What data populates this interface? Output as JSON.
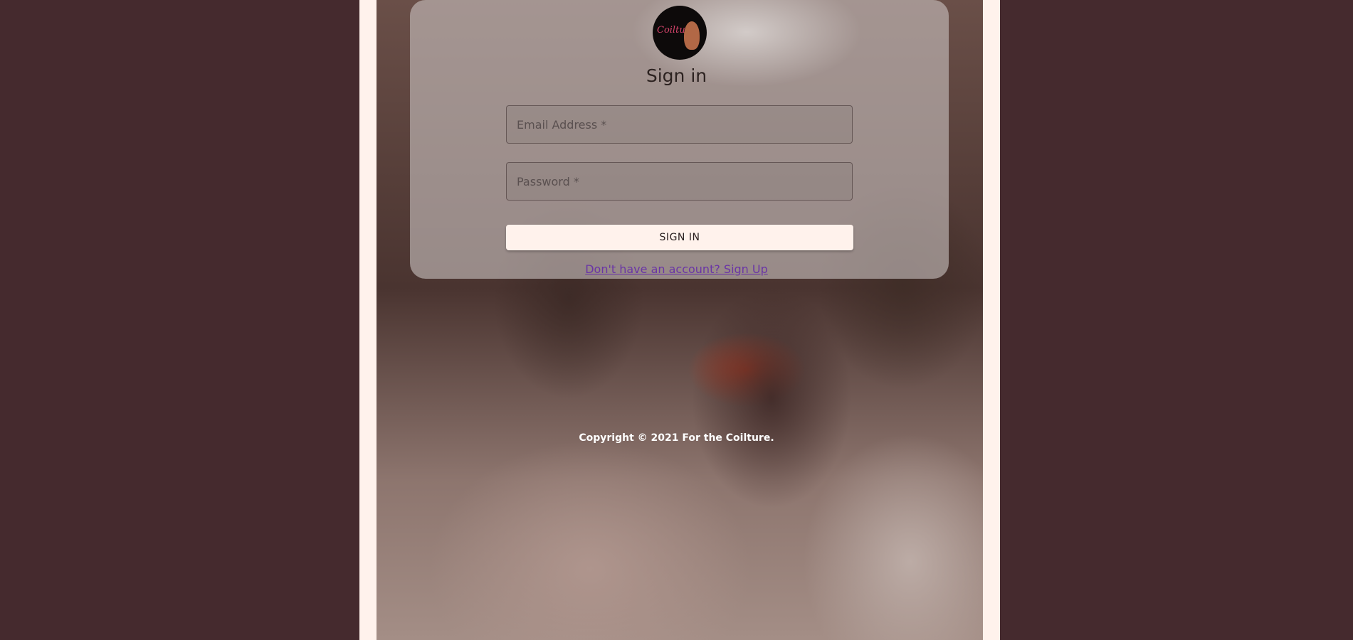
{
  "logo": {
    "text": "Coilture"
  },
  "signin": {
    "title": "Sign in",
    "email_placeholder": "Email Address *",
    "password_placeholder": "Password *",
    "button_label": "SIGN IN",
    "signup_link": "Don't have an account? Sign Up"
  },
  "footer": {
    "copyright": "Copyright © 2021 For the Coilture."
  },
  "colors": {
    "outer_background": "#452a2e",
    "column_background": "#fff2ec",
    "link": "#6a35a6",
    "button_background": "#fff2ec"
  }
}
